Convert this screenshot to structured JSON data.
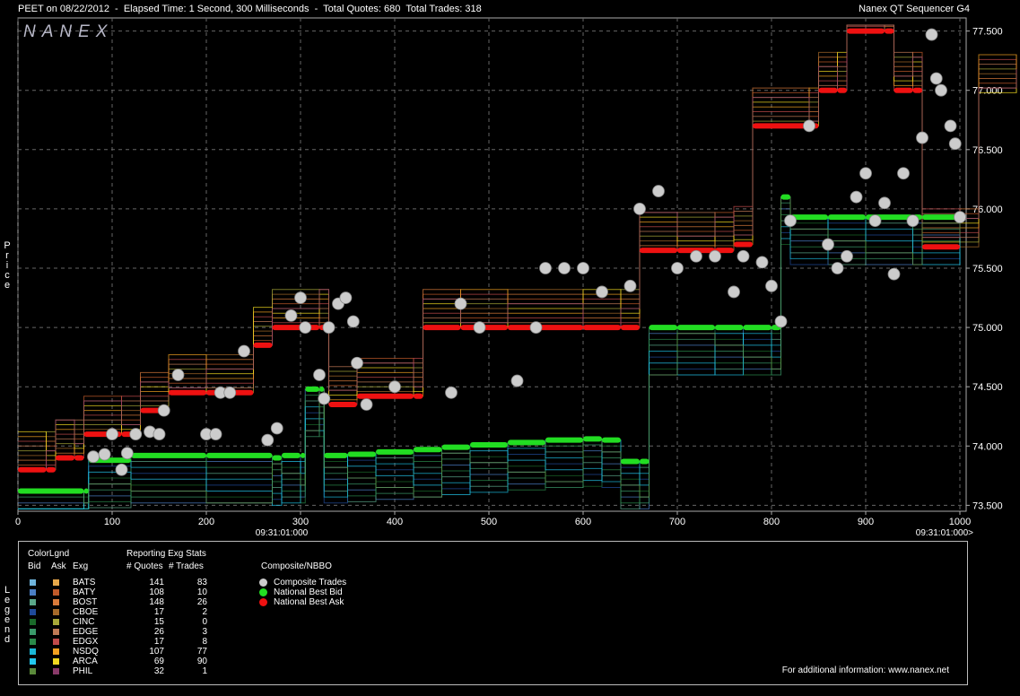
{
  "header": {
    "left": "PEET on 08/22/2012  -  Elapsed Time: 1 Second, 300 Milliseconds  -  Total Quotes: 680  Total Trades: 318",
    "right": "Nanex QT Sequencer G4",
    "logo": "NANEX",
    "price_axis_label": "Price",
    "legend_axis_label": "Legend"
  },
  "chart_data": {
    "type": "scatter",
    "xlim": [
      0,
      1000
    ],
    "ylim": [
      73.45,
      77.55
    ],
    "x_ticks": [
      "0",
      "100",
      "200",
      "300",
      "400",
      "500",
      "600",
      "700",
      "800",
      "900",
      "1000"
    ],
    "y_ticks": [
      "73.500",
      "74.000",
      "74.500",
      "75.000",
      "75.500",
      "76.000",
      "76.500",
      "77.000",
      "77.500"
    ],
    "time_labels": [
      "09:31:01:000",
      "09:31:01:000>"
    ],
    "grid": true,
    "series": [
      {
        "name": "National Best Bid",
        "color": "#22dd22",
        "points": [
          [
            0,
            73.62
          ],
          [
            70,
            73.62
          ],
          [
            75,
            73.88
          ],
          [
            120,
            73.92
          ],
          [
            200,
            73.92
          ],
          [
            270,
            73.9
          ],
          [
            280,
            73.92
          ],
          [
            300,
            73.92
          ],
          [
            305,
            74.48
          ],
          [
            320,
            74.48
          ],
          [
            325,
            73.92
          ],
          [
            350,
            73.93
          ],
          [
            380,
            73.95
          ],
          [
            420,
            73.97
          ],
          [
            450,
            73.99
          ],
          [
            480,
            74.01
          ],
          [
            520,
            74.03
          ],
          [
            560,
            74.05
          ],
          [
            600,
            74.06
          ],
          [
            620,
            74.05
          ],
          [
            640,
            73.87
          ],
          [
            660,
            73.87
          ],
          [
            670,
            75.0
          ],
          [
            700,
            75.0
          ],
          [
            740,
            75.0
          ],
          [
            770,
            75.0
          ],
          [
            800,
            75.0
          ],
          [
            810,
            76.1
          ],
          [
            820,
            75.93
          ],
          [
            860,
            75.93
          ],
          [
            900,
            75.93
          ],
          [
            950,
            75.93
          ],
          [
            960,
            75.93
          ],
          [
            1000,
            75.93
          ]
        ]
      },
      {
        "name": "National Best Ask",
        "color": "#ee1111",
        "points": [
          [
            0,
            73.8
          ],
          [
            30,
            73.8
          ],
          [
            40,
            73.9
          ],
          [
            60,
            73.9
          ],
          [
            70,
            74.1
          ],
          [
            110,
            74.1
          ],
          [
            130,
            74.3
          ],
          [
            160,
            74.45
          ],
          [
            200,
            74.45
          ],
          [
            250,
            74.85
          ],
          [
            270,
            75.0
          ],
          [
            320,
            75.0
          ],
          [
            330,
            74.35
          ],
          [
            360,
            74.42
          ],
          [
            420,
            74.42
          ],
          [
            430,
            75.0
          ],
          [
            470,
            75.0
          ],
          [
            520,
            75.0
          ],
          [
            600,
            75.0
          ],
          [
            640,
            75.0
          ],
          [
            660,
            75.65
          ],
          [
            700,
            75.65
          ],
          [
            740,
            75.65
          ],
          [
            760,
            75.7
          ],
          [
            780,
            76.7
          ],
          [
            840,
            76.7
          ],
          [
            850,
            77.0
          ],
          [
            870,
            77.0
          ],
          [
            880,
            77.5
          ],
          [
            920,
            77.5
          ],
          [
            930,
            77.0
          ],
          [
            950,
            77.0
          ],
          [
            960,
            75.68
          ],
          [
            1000,
            75.68
          ],
          [
            1020,
            76.98
          ],
          [
            1060,
            76.98
          ]
        ]
      },
      {
        "name": "Composite Trades",
        "color": "#cccccc",
        "points": [
          [
            80,
            73.91
          ],
          [
            92,
            73.93
          ],
          [
            100,
            74.1
          ],
          [
            110,
            73.8
          ],
          [
            116,
            73.94
          ],
          [
            125,
            74.1
          ],
          [
            140,
            74.12
          ],
          [
            150,
            74.1
          ],
          [
            155,
            74.3
          ],
          [
            170,
            74.6
          ],
          [
            200,
            74.1
          ],
          [
            210,
            74.1
          ],
          [
            215,
            74.45
          ],
          [
            225,
            74.45
          ],
          [
            240,
            74.8
          ],
          [
            265,
            74.05
          ],
          [
            275,
            74.15
          ],
          [
            290,
            75.1
          ],
          [
            300,
            75.25
          ],
          [
            305,
            75.0
          ],
          [
            320,
            74.6
          ],
          [
            325,
            74.4
          ],
          [
            330,
            75.0
          ],
          [
            340,
            75.2
          ],
          [
            348,
            75.25
          ],
          [
            356,
            75.05
          ],
          [
            360,
            74.7
          ],
          [
            370,
            74.35
          ],
          [
            400,
            74.5
          ],
          [
            460,
            74.45
          ],
          [
            470,
            75.2
          ],
          [
            490,
            75.0
          ],
          [
            530,
            74.55
          ],
          [
            550,
            75.0
          ],
          [
            560,
            75.5
          ],
          [
            580,
            75.5
          ],
          [
            600,
            75.5
          ],
          [
            620,
            75.3
          ],
          [
            650,
            75.35
          ],
          [
            660,
            76.0
          ],
          [
            680,
            76.15
          ],
          [
            700,
            75.5
          ],
          [
            720,
            75.6
          ],
          [
            740,
            75.6
          ],
          [
            760,
            75.3
          ],
          [
            770,
            75.6
          ],
          [
            790,
            75.55
          ],
          [
            800,
            75.35
          ],
          [
            810,
            75.05
          ],
          [
            820,
            75.9
          ],
          [
            840,
            76.7
          ],
          [
            860,
            75.7
          ],
          [
            870,
            75.5
          ],
          [
            880,
            75.6
          ],
          [
            890,
            76.1
          ],
          [
            900,
            76.3
          ],
          [
            910,
            75.9
          ],
          [
            920,
            76.05
          ],
          [
            930,
            75.45
          ],
          [
            940,
            76.3
          ],
          [
            950,
            75.9
          ],
          [
            960,
            76.6
          ],
          [
            970,
            77.47
          ],
          [
            975,
            77.1
          ],
          [
            980,
            77.0
          ],
          [
            990,
            76.7
          ],
          [
            995,
            76.55
          ],
          [
            1000,
            75.93
          ]
        ]
      }
    ]
  },
  "legend": {
    "colorlgnd_label": "ColorLgnd",
    "reporting_label": "Reporting Exg Stats",
    "col_bid": "Bid",
    "col_ask": "Ask",
    "col_exg": "Exg",
    "col_quotes": "# Quotes",
    "col_trades": "# Trades",
    "composite_label": "Composite/NBBO",
    "exchanges": [
      {
        "exg": "BATS",
        "quotes": "141",
        "trades": "83",
        "bid_color": "#6fb4dc",
        "ask_color": "#e8a84a"
      },
      {
        "exg": "BATY",
        "quotes": "108",
        "trades": "10",
        "bid_color": "#4a7ec4",
        "ask_color": "#c05a2a"
      },
      {
        "exg": "BOST",
        "quotes": "148",
        "trades": "26",
        "bid_color": "#5aa88a",
        "ask_color": "#d87a3a"
      },
      {
        "exg": "CBOE",
        "quotes": "17",
        "trades": "2",
        "bid_color": "#1f4a9a",
        "ask_color": "#a56a2a"
      },
      {
        "exg": "CINC",
        "quotes": "15",
        "trades": "0",
        "bid_color": "#1a6a2a",
        "ask_color": "#a8a838"
      },
      {
        "exg": "EDGE",
        "quotes": "26",
        "trades": "3",
        "bid_color": "#3a9a6a",
        "ask_color": "#c07a55"
      },
      {
        "exg": "EDGX",
        "quotes": "17",
        "trades": "8",
        "bid_color": "#2a8a4a",
        "ask_color": "#c04a4a"
      },
      {
        "exg": "NSDQ",
        "quotes": "107",
        "trades": "77",
        "bid_color": "#1ab8d8",
        "ask_color": "#f0a020"
      },
      {
        "exg": "ARCA",
        "quotes": "69",
        "trades": "90",
        "bid_color": "#22c8ee",
        "ask_color": "#f0d820"
      },
      {
        "exg": "PHIL",
        "quotes": "32",
        "trades": "1",
        "bid_color": "#5a8a3a",
        "ask_color": "#8a3a6a"
      }
    ],
    "composite_items": [
      {
        "label": "Composite Trades",
        "color": "#cccccc"
      },
      {
        "label": "National Best Bid",
        "color": "#22dd22"
      },
      {
        "label": "National Best Ask",
        "color": "#ee1111"
      }
    ],
    "footer": "For additional information: www.nanex.net"
  }
}
